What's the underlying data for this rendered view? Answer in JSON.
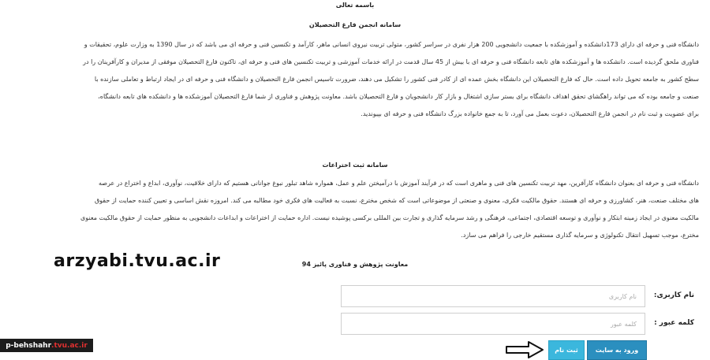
{
  "header": {
    "title": "باسمه تعالی",
    "section1_title": "سامانه انجمن فارغ التحصیلان",
    "section2_title": "سامانه ثبت اختراعات"
  },
  "section1": {
    "lines": [
      "دانشگاه فنی و حرفه ای دارای 173دانشکده و آموزشکده با جمعیت دانشجویی 200 هزار نفری در سراسر کشور، متولی تربیت نیروی انسانی ماهر، کارآمد و تکنسین فنی و حرفه ای می باشد که در سال 1390 به وزارت علوم، تحقیقات و",
      "فناوری ملحق گردیده است. دانشکده ها و آموزشکده های تابعه دانشگاه فنی و حرفه ای با بیش از 45 سال قدمت در ارائه خدمات آموزشی و تربیت تکنسین های فنی و حرفه ای، تاکنون فارغ التحصیلان موفقی از مدیران و کارآفرینان را در",
      "سطح کشور به جامعه تحویل داده است. حال که فارغ التحصیلان این دانشگاه بخش عمده ای از کادر فنی کشور را تشکیل می دهند، ضرورت تاسیس انجمن فارغ التحصیلان و دانشگاه فنی و حرفه ای در ایجاد ارتباط و تعاملی سازنده با",
      "صنعت و جامعه بوده که می تواند راهگشای تحقق اهداف دانشگاه برای بستر سازی اشتغال و بازار کار دانشجویان و فارغ التحصیلان باشد. معاونت پژوهش و فناوری از شما فارغ التحصیلان آموزشکده ها و دانشکده های تابعه دانشگاه،",
      "برای عضویت و ثبت نام در انجمن فارغ التحصیلان، دعوت بعمل می آورد، تا به جمع خانواده بزرگ دانشگاه فنی و حرفه ای بپیوندید."
    ]
  },
  "section2": {
    "lines": [
      "دانشگاه فنی و حرفه ای بعنوان دانشگاه کارآفرین، مهد تربیت تکنسین های فنی و ماهری است که در فرآیند آموزش با درآمیختن علم و عمل، همواره شاهد تبلور نبوغ جوانانی هستیم که دارای خلاقیت، نوآوری، ابداع و اختراع در عرصه",
      "های مختلف صنعت، هنر، کشاورزی و حرفه ای هستند. حقوق مالکیت فکری، معنوی و صنعتی از موضوعاتی است که شخص مخترع، نسبت به فعالیت های فکری خود مطالبه می کند. امروزه نقش اساسی و تعیین کننده حمایت از حقوق",
      "مالکیت معنوی در ایجاد زمینه ابتکار و نوآوری و توسعه اقتصادی، اجتماعی، فرهنگی و رشد سرمایه گذاری و تجارت بین المللی برکسی پوشیده نیست. اداره حمایت از اختراعات و ابداعات دانشجویی به منظور حمایت از حقوق مالکیت معنوی",
      "مخترع، موجب تسهیل انتقال تکنولوژی و سرمایه گذاری مستقیم خارجی را فراهم می سازد."
    ],
    "signature": "معاونت پژوهش و فناوری پائیز 94"
  },
  "watermark": "arzyabi.tvu.ac.ir",
  "form": {
    "username_label": "نام کاربری:",
    "username_placeholder": "نام کاربری",
    "username_value": "",
    "password_label": "کلمه عبور :",
    "password_placeholder": "کلمه عبور",
    "password_value": ""
  },
  "buttons": {
    "login_label": "ورود به سایت",
    "register_label": "ثبت نام"
  },
  "badge": {
    "prefix": "p-behshahr",
    "suffix": ".tvu.ac.ir"
  },
  "colors": {
    "button_primary": "#2b8fbf",
    "button_secondary": "#3bb7dd",
    "badge_bg": "#1c1c1c",
    "badge_accent": "#e03030"
  }
}
